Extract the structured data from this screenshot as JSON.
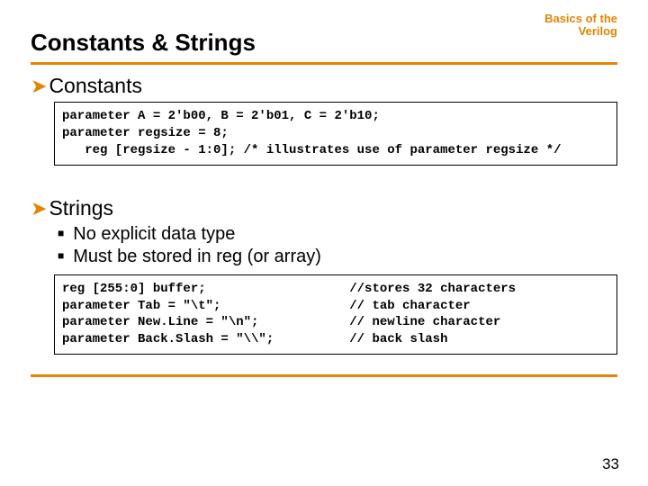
{
  "header": {
    "title": "Constants & Strings",
    "topic_line1": "Basics of the",
    "topic_line2": "Verilog"
  },
  "sections": {
    "constants": {
      "heading": "Constants",
      "code_line1": "parameter A = 2'b00, B = 2'b01, C = 2'b10;",
      "code_line2": "parameter regsize = 8;",
      "code_line3": "   reg [regsize - 1:0]; /* illustrates use of parameter regsize */"
    },
    "strings": {
      "heading": "Strings",
      "bullets": [
        "No explicit data type",
        "Must be stored in reg (or array)"
      ],
      "code_left_line1": "reg [255:0] buffer;",
      "code_left_line2": "parameter Tab = \"\\t\";",
      "code_left_line3": "parameter New.Line = \"\\n\";",
      "code_left_line4": "parameter Back.Slash = \"\\\\\";",
      "code_right_line1": "//stores 32 characters",
      "code_right_line2": "// tab character",
      "code_right_line3": "// newline character",
      "code_right_line4": "// back slash"
    }
  },
  "page_number": "33"
}
